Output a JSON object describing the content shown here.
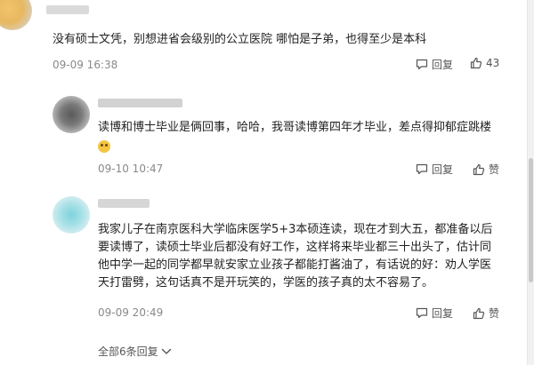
{
  "comments": [
    {
      "text": "没有硕士文凭，别想进省会级别的公立医院 哪怕是子弟，也得至少是本科",
      "time": "09-09 16:38",
      "reply_label": "回复",
      "like_label": "43"
    },
    {
      "text": "读博和博士毕业是俩回事，哈哈，我哥读博第四年才毕业，差点得抑郁症跳楼",
      "time": "09-10 10:47",
      "reply_label": "回复",
      "like_label": "赞"
    },
    {
      "lines": [
        "我家儿子在南京医科大学临床医学5+3本硕连读，现在才到大五，都准备以后",
        "要读博了，读硕士毕业后都没有好工作，这样将来毕业都三十出头了，估计同",
        "他中学一起的同学都早就安家立业孩子都能打酱油了，有话说的好：劝人学医",
        "天打雷劈，这句话真不是开玩笑的，学医的孩子真的太不容易了。"
      ],
      "time": "09-09 20:49",
      "reply_label": "回复",
      "like_label": "赞"
    }
  ],
  "expand_label": "全部6条回复",
  "colors": {
    "meta": "#8a8a8a",
    "text": "#222222"
  }
}
